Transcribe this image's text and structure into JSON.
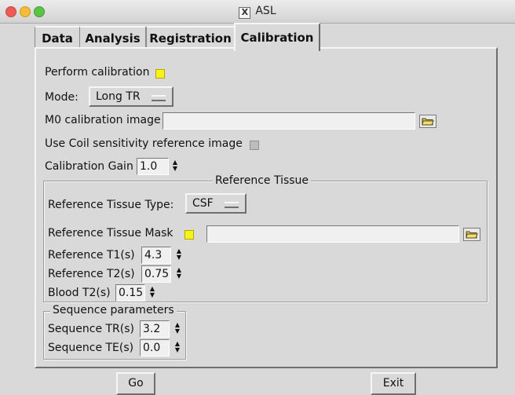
{
  "window": {
    "title": "ASL"
  },
  "tabs": [
    {
      "label": "Data"
    },
    {
      "label": "Analysis"
    },
    {
      "label": "Registration"
    },
    {
      "label": "Calibration"
    }
  ],
  "calibration": {
    "perform_label": "Perform calibration",
    "perform_checked": true,
    "mode_label": "Mode:",
    "mode_value": "Long TR",
    "m0_label": "M0 calibration image",
    "m0_value": "",
    "coil_label": "Use Coil sensitivity reference image",
    "coil_checked": false,
    "gain_label": "Calibration Gain",
    "gain_value": "1.0"
  },
  "reference_tissue": {
    "group_title": "Reference Tissue",
    "type_label": "Reference Tissue Type:",
    "type_value": "CSF",
    "mask_label": "Reference Tissue Mask",
    "mask_checked": true,
    "mask_value": "",
    "t1_label": "Reference T1(s)",
    "t1_value": "4.3",
    "t2_label": "Reference T2(s)",
    "t2_value": "0.75",
    "blood_t2_label": "Blood T2(s)",
    "blood_t2_value": "0.15"
  },
  "sequence": {
    "group_title": "Sequence parameters",
    "tr_label": "Sequence TR(s)",
    "tr_value": "3.2",
    "te_label": "Sequence TE(s)",
    "te_value": "0.0"
  },
  "buttons": {
    "go": "Go",
    "exit": "Exit"
  },
  "colors": {
    "check_on": "#f7f21a",
    "check_off": "#bdbdbd",
    "background": "#d9d9d9"
  }
}
